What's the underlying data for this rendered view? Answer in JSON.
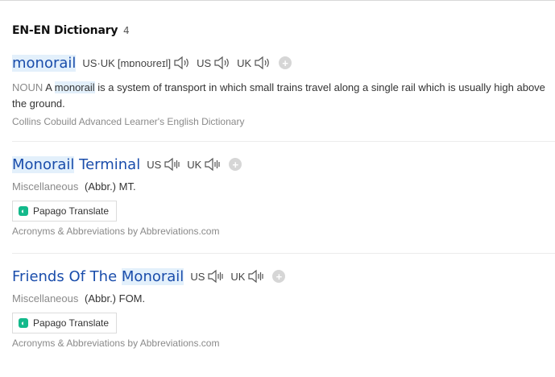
{
  "section": {
    "title": "EN-EN Dictionary",
    "count": "4"
  },
  "entries": [
    {
      "headword": "monorail",
      "pron_label": "US·UK",
      "ipa": "[mɒnoʊreɪl]",
      "us_label": "US",
      "uk_label": "UK",
      "pos": "NOUN",
      "def_pre": "A",
      "def_word": "monorail",
      "def_post": "is a system of transport in which small trains travel along a single rail which is usually high above the ground.",
      "source": "Collins Cobuild Advanced Learner's English Dictionary"
    },
    {
      "headword_hl": "Monorail",
      "headword_rest": "Terminal",
      "us_label": "US",
      "uk_label": "UK",
      "category": "Miscellaneous",
      "abbr": "(Abbr.) MT.",
      "translate": "Papago Translate",
      "source": "Acronyms & Abbreviations by Abbreviations.com"
    },
    {
      "headword_pre": "Friends Of The",
      "headword_hl": "Monorail",
      "us_label": "US",
      "uk_label": "UK",
      "category": "Miscellaneous",
      "abbr": "(Abbr.) FOM.",
      "translate": "Papago Translate",
      "source": "Acronyms & Abbreviations by Abbreviations.com"
    }
  ],
  "icons": {
    "speaker": "speaker-icon",
    "add": "plus-icon",
    "papago": "papago-icon"
  },
  "colors": {
    "headword": "#1a4dab",
    "highlight": "#e3f0fb",
    "muted": "#8a8a8a",
    "papago": "#13b98b"
  }
}
